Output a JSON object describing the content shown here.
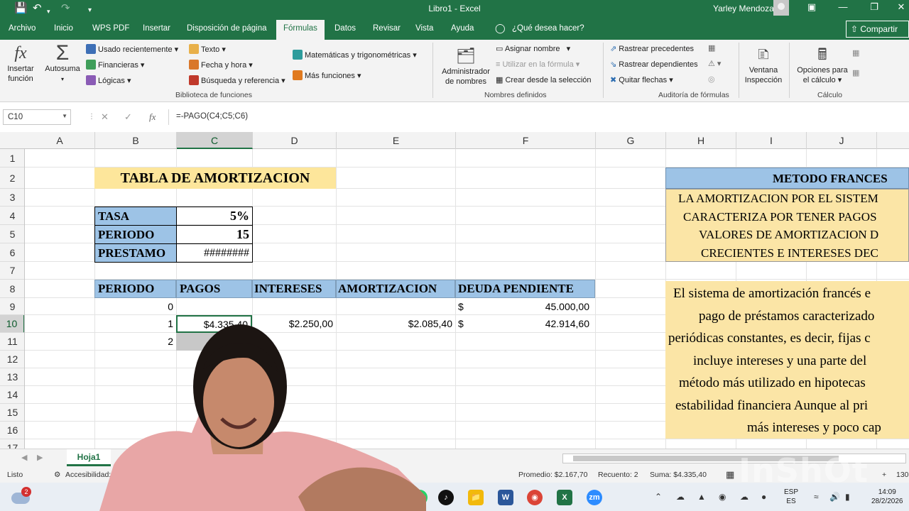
{
  "titlebar": {
    "title": "Libro1  -  Excel",
    "user": "Yarley Mendoza"
  },
  "tabs": [
    "Archivo",
    "Inicio",
    "WPS PDF",
    "Insertar",
    "Disposición de página",
    "Fórmulas",
    "Datos",
    "Revisar",
    "Vista",
    "Ayuda"
  ],
  "active_tab": "Fórmulas",
  "tell_me": "¿Qué desea hacer?",
  "share_label": "Compartir",
  "ribbon": {
    "insertar_funcion": [
      "Insertar",
      "función"
    ],
    "autosuma": "Autosuma",
    "usado_recientemente": "Usado recientemente",
    "financieras": "Financieras",
    "logicas": "Lógicas",
    "texto": "Texto",
    "fecha_hora": "Fecha y hora",
    "busqueda": "Búsqueda y referencia",
    "matematicas": "Matemáticas y trigonométricas",
    "mas_funciones": "Más funciones",
    "group_biblioteca": "Biblioteca de funciones",
    "administrador": [
      "Administrador",
      "de nombres"
    ],
    "asignar_nombre": "Asignar nombre",
    "utilizar_formula": "Utilizar en la fórmula",
    "crear_seleccion": "Crear desde la selección",
    "group_nombres": "Nombres definidos",
    "rastrear_precedentes": "Rastrear precedentes",
    "rastrear_dependientes": "Rastrear dependientes",
    "quitar_flechas": "Quitar flechas",
    "ventana": [
      "Ventana",
      "Inspección"
    ],
    "group_auditoria": "Auditoría de fórmulas",
    "opciones_calculo": [
      "Opciones para",
      "el cálculo"
    ],
    "group_calculo": "Cálculo"
  },
  "formula_bar": {
    "name_box": "C10",
    "formula": "=-PAGO(C4;C5;C6)"
  },
  "columns": [
    "A",
    "B",
    "C",
    "D",
    "E",
    "F",
    "G",
    "H",
    "I",
    "J"
  ],
  "rows": [
    "1",
    "2",
    "3",
    "4",
    "5",
    "6",
    "7",
    "8",
    "9",
    "10",
    "11",
    "12",
    "13",
    "14",
    "15",
    "16",
    "17"
  ],
  "sheet": {
    "title": "TABLA DE AMORTIZACION",
    "params": [
      {
        "label": "TASA",
        "value": "5%"
      },
      {
        "label": "PERIODO",
        "value": "15"
      },
      {
        "label": "PRESTAMO",
        "value": "########"
      }
    ],
    "headers": [
      "PERIODO",
      "PAGOS",
      "INTERESES",
      "AMORTIZACION",
      "DEUDA PENDIENTE"
    ],
    "rows": [
      {
        "periodo": "0",
        "pagos": "",
        "intereses": "",
        "amortizacion": "",
        "deuda_sym": "$",
        "deuda": "45.000,00"
      },
      {
        "periodo": "1",
        "pagos": "$4.335,40",
        "intereses": "$2.250,00",
        "amortizacion": "$2.085,40",
        "deuda_sym": "$",
        "deuda": "42.914,60"
      },
      {
        "periodo": "2",
        "pagos": "",
        "intereses": "",
        "amortizacion": "",
        "deuda_sym": "",
        "deuda": ""
      }
    ],
    "metodo_title": "METODO FRANCES",
    "metodo_lines": [
      "LA AMORTIZACION POR EL SISTEM",
      "CARACTERIZA POR TENER PAGOS",
      "VALORES DE AMORTIZACION D",
      "CRECIENTES E INTERESES DEC"
    ],
    "desc_lines": [
      "El sistema de amortización francés e",
      "pago de préstamos caracterizado",
      "periódicas constantes, es decir, fijas c",
      "incluye intereses y una parte del",
      "método más utilizado en hipotecas",
      "estabilidad financiera Aunque al pri",
      "más intereses y poco cap"
    ]
  },
  "sheet_tab": "Hoja1",
  "status": {
    "ready": "Listo",
    "accessibility": "Accesibilidad: todo",
    "promedio": "Promedio: $2.167,70",
    "recuento": "Recuento: 2",
    "suma": "Suma: $4.335,40",
    "zoom": "130"
  },
  "taskbar": {
    "notifications": "2",
    "lang": [
      "ESP",
      "ES"
    ],
    "time": "14:09",
    "date": "28/2/2026"
  },
  "watermark": "InShOt",
  "colors": {
    "excel_green": "#217346",
    "header_blue": "#9dc3e6",
    "title_yellow": "#fde69b",
    "panel_yellow": "#fbe5a6"
  }
}
